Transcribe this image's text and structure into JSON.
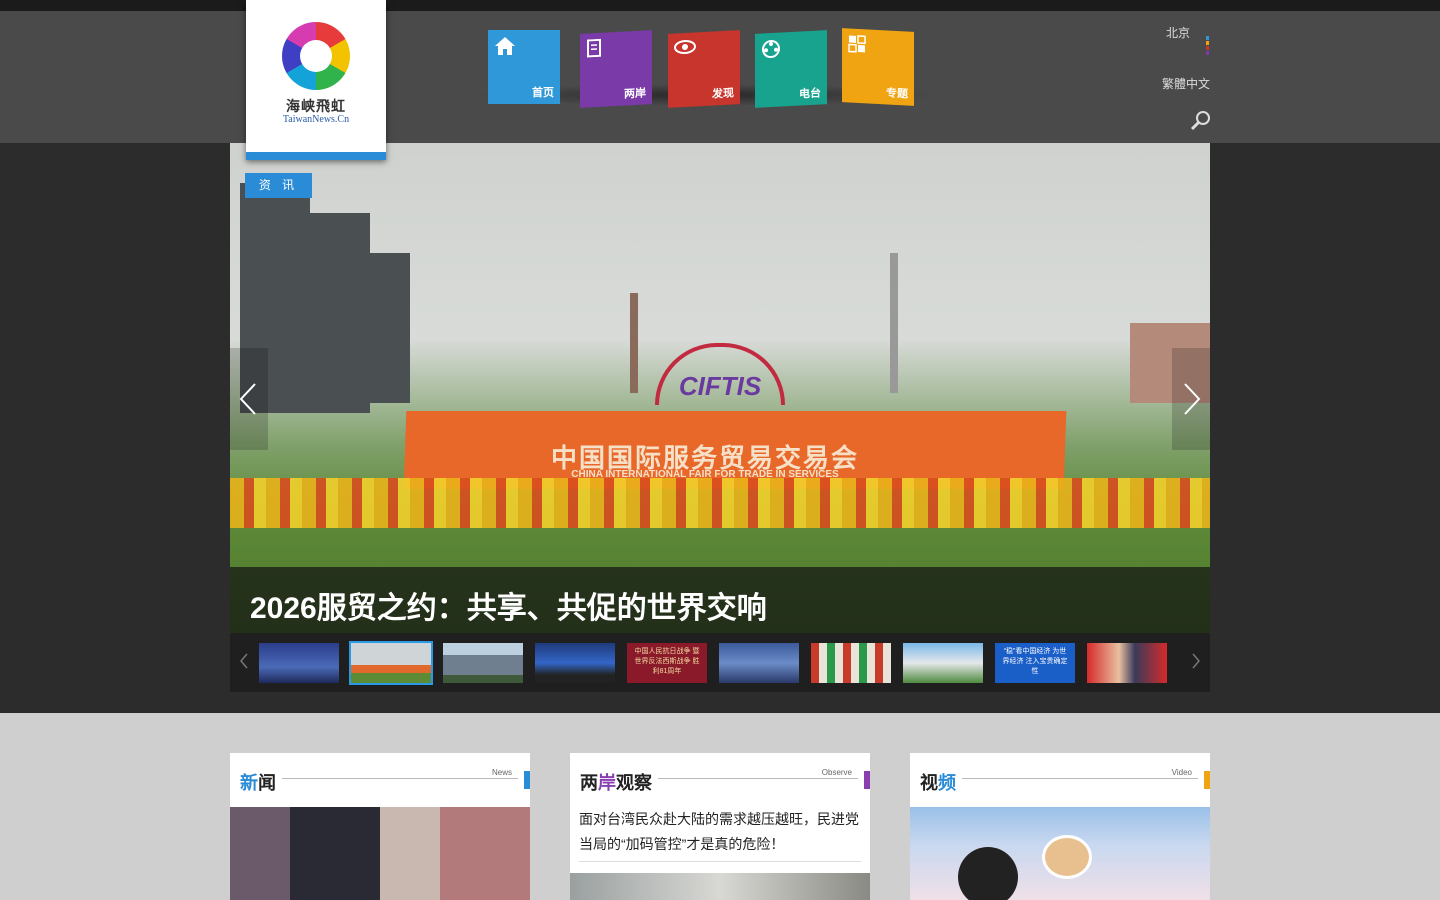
{
  "header": {
    "logo": {
      "cn": "海峡飛虹",
      "en": "TaiwanNews.Cn"
    },
    "nav": [
      {
        "label": "首页",
        "icon": "home-icon",
        "color": "#2f98d8"
      },
      {
        "label": "两岸",
        "icon": "document-icon",
        "color": "#7a3aa8"
      },
      {
        "label": "发现",
        "icon": "eye-icon",
        "color": "#c8352c"
      },
      {
        "label": "电台",
        "icon": "film-reel-icon",
        "color": "#18a38e"
      },
      {
        "label": "专题",
        "icon": "grid-icon",
        "color": "#f0a412"
      }
    ],
    "city": "北京",
    "traditional": "繁體中文",
    "search_icon": "search-icon"
  },
  "hero": {
    "tag": "资 讯",
    "headline": "2026服贸之约：共享、共促的世界交响",
    "sign_text": "中国国际服务贸易交易会",
    "sign_subtext": "CHINA INTERNATIONAL FAIR FOR TRADE IN SERVICES",
    "emblem_text": "CIFTIS",
    "prev_icon": "chevron-left-icon",
    "next_icon": "chevron-right-icon"
  },
  "thumbnails": [
    {
      "label": "",
      "active": false
    },
    {
      "label": "",
      "active": true
    },
    {
      "label": "",
      "active": false
    },
    {
      "label": "",
      "active": false
    },
    {
      "label": "中国人民抗日战争 暨世界反法西斯战争 胜利81周年",
      "active": false
    },
    {
      "label": "",
      "active": false
    },
    {
      "label": "",
      "active": false
    },
    {
      "label": "",
      "active": false
    },
    {
      "label": "“稳”看中国经济 为世界经济 注入宝贵确定性",
      "active": false
    },
    {
      "label": "",
      "active": false
    }
  ],
  "sections": {
    "news": {
      "title_a": "新",
      "title_b": "闻",
      "en": "News",
      "accent": "#2a8bd6"
    },
    "observe": {
      "title_a": "两",
      "title_mid": "岸",
      "title_b": "观察",
      "en": "Observe",
      "accent": "#8a3fb0",
      "headline": "面对台湾民众赴大陆的需求越压越旺，民进党当局的“加码管控”才是真的危险！"
    },
    "video": {
      "title_a": "视",
      "title_b": "频",
      "en": "Video",
      "accent": "#f0a412"
    }
  }
}
